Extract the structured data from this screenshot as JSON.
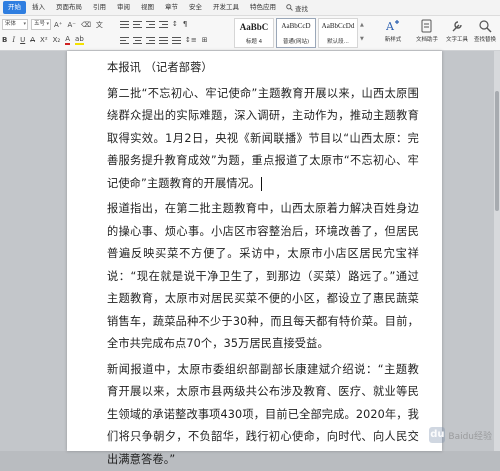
{
  "menubar": {
    "tabs": [
      {
        "label": "开始",
        "active": true
      },
      {
        "label": "插入",
        "active": false
      },
      {
        "label": "页面布局",
        "active": false
      },
      {
        "label": "引用",
        "active": false
      },
      {
        "label": "审阅",
        "active": false
      },
      {
        "label": "视图",
        "active": false
      },
      {
        "label": "章节",
        "active": false
      },
      {
        "label": "安全",
        "active": false
      },
      {
        "label": "开发工具",
        "active": false
      },
      {
        "label": "特色应用",
        "active": false
      }
    ],
    "search_label": "查找",
    "accent_color": "#2f7ee0"
  },
  "ribbon": {
    "font_name": "宋体",
    "font_size": "五号",
    "styles": [
      {
        "sample": "AaBbC",
        "caption": "标题 4"
      },
      {
        "sample": "AaBbCcD",
        "caption": "普通(网站)"
      },
      {
        "sample": "AaBbCcDd",
        "caption": "默认段..."
      }
    ],
    "new_style_label": "新样式",
    "wenzi_assistant_label": "文档助手",
    "text_tools_label": "文字工具",
    "find_replace_label": "查找替换"
  },
  "document": {
    "paragraphs": [
      "本报讯 （记者部蓉）",
      "第二批“不忘初心、牢记使命”主题教育开展以来，山西太原围绕群众提出的实际难题，深入调研，主动作为，推动主题教育取得实效。1月2日，央视《新闻联播》节目以“山西太原：完善服务提升教育成效”为题，重点报道了太原市“不忘初心、牢记使命”主题教育的开展情况。",
      "报道指出，在第二批主题教育中，山西太原着力解决百姓身边的操心事、烦心事。小店区市容整治后，环境改善了，但居民普遍反映买菜不方便了。采访中，太原市小店区居民宂宝祥说：“现在就是说干净卫生了，到那边（买菜）路远了。”通过主题教育，太原市对居民买菜不便的小区，都设立了惠民蔬菜销售车，蔬菜品种不少于30种，而且每天都有特价菜。目前，全市共完成布点70个，35万居民直接受益。",
      "新闻报道中，太原市委组织部副部长康建斌介绍说：“主题教育开展以来，太原市县两级共公布涉及教育、医疗、就业等民生领域的承诺整改事项430项，目前已全部完成。2020年，我们将只争朝夕，不负韶华，践行初心使命，向时代、向人民交出满意答卷。”"
    ]
  },
  "watermark": {
    "text": "Baidu经验",
    "paw": "du"
  }
}
